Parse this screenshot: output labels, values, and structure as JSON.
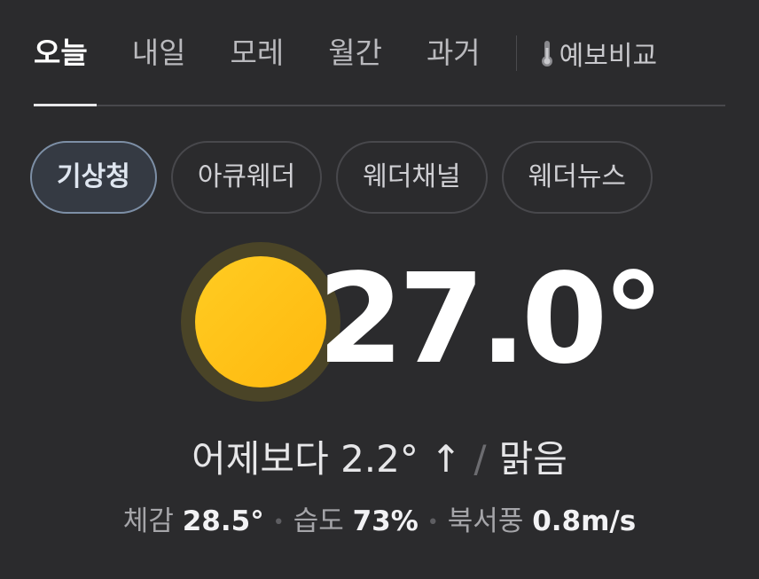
{
  "tabs": [
    {
      "label": "오늘",
      "active": true
    },
    {
      "label": "내일",
      "active": false
    },
    {
      "label": "모레",
      "active": false
    },
    {
      "label": "월간",
      "active": false
    },
    {
      "label": "과거",
      "active": false
    }
  ],
  "compare": {
    "label": "예보비교",
    "icon": "thermometer-icon"
  },
  "sources": [
    {
      "label": "기상청",
      "selected": true
    },
    {
      "label": "아큐웨더",
      "selected": false
    },
    {
      "label": "웨더채널",
      "selected": false
    },
    {
      "label": "웨더뉴스",
      "selected": false
    }
  ],
  "weather": {
    "icon": "sun-icon",
    "temperature": "27.0°",
    "compare_text": "어제보다 2.2° ↑",
    "condition": "맑음"
  },
  "details": {
    "feels_like_label": "체감",
    "feels_like_value": "28.5°",
    "humidity_label": "습도",
    "humidity_value": "73%",
    "wind_label": "북서풍",
    "wind_value": "0.8m/s"
  },
  "colors": {
    "background": "#2b2b2d",
    "sun": "#ffc21a",
    "selected_chip_border": "#7d8fa6"
  }
}
